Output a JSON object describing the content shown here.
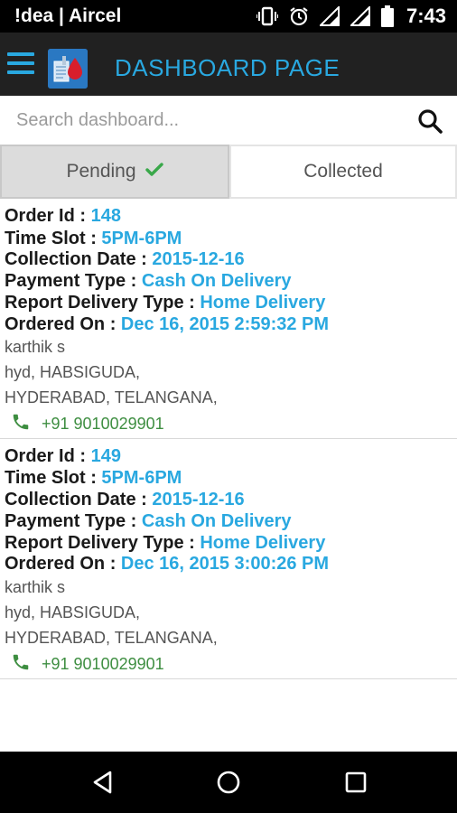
{
  "status_bar": {
    "carrier": "!dea | Aircel",
    "time": "7:43",
    "icons": [
      "vibrate-icon",
      "alarm-icon",
      "signal-icon",
      "signal-icon",
      "battery-icon"
    ]
  },
  "app_bar": {
    "title": "DASHBOARD PAGE",
    "accent_color": "#29a8e0"
  },
  "search": {
    "placeholder": "Search dashboard..."
  },
  "tabs": {
    "pending_label": "Pending",
    "collected_label": "Collected",
    "selected": "Pending"
  },
  "labels": {
    "order_id": "Order Id : ",
    "time_slot": "Time Slot : ",
    "collection_date": "Collection Date : ",
    "payment_type": "Payment Type : ",
    "report_delivery_type": "Report Delivery Type : ",
    "ordered_on": "Ordered On : "
  },
  "orders": [
    {
      "order_id": "148",
      "time_slot": "5PM-6PM",
      "collection_date": "2015-12-16",
      "payment_type": "Cash On Delivery",
      "report_delivery_type": "Home Delivery",
      "ordered_on": "Dec 16, 2015 2:59:32 PM",
      "name": "karthik s",
      "address_line1": "hyd, HABSIGUDA,",
      "address_line2": "HYDERABAD, TELANGANA,",
      "phone": "+91 9010029901"
    },
    {
      "order_id": "149",
      "time_slot": "5PM-6PM",
      "collection_date": "2015-12-16",
      "payment_type": "Cash On Delivery",
      "report_delivery_type": "Home Delivery",
      "ordered_on": "Dec 16, 2015 3:00:26 PM",
      "name": "karthik s",
      "address_line1": "hyd, HABSIGUDA,",
      "address_line2": "HYDERABAD, TELANGANA,",
      "phone": "+91 9010029901"
    }
  ]
}
